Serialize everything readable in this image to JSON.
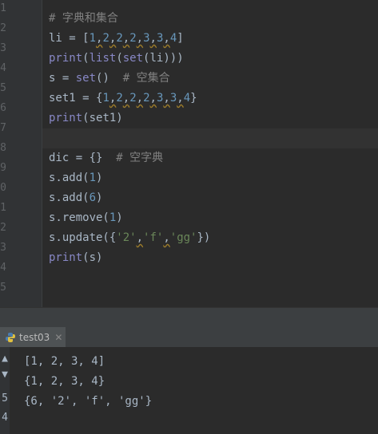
{
  "editor": {
    "line_numbers": [
      "1",
      "2",
      "3",
      "4",
      "5",
      "6",
      "7",
      "8",
      "9",
      "0",
      "1",
      "2",
      "3",
      "4",
      "5"
    ],
    "lines": [
      [
        {
          "t": "com",
          "v": "# 字典和集合"
        }
      ],
      [
        {
          "t": "p",
          "v": "li = ["
        },
        {
          "t": "num",
          "v": "1"
        },
        {
          "t": "typo",
          "v": ","
        },
        {
          "t": "num",
          "v": "2"
        },
        {
          "t": "typo",
          "v": ","
        },
        {
          "t": "num",
          "v": "2"
        },
        {
          "t": "typo",
          "v": ","
        },
        {
          "t": "num",
          "v": "2"
        },
        {
          "t": "typo",
          "v": ","
        },
        {
          "t": "num",
          "v": "3"
        },
        {
          "t": "typo",
          "v": ","
        },
        {
          "t": "num",
          "v": "3"
        },
        {
          "t": "typo",
          "v": ","
        },
        {
          "t": "num",
          "v": "4"
        },
        {
          "t": "p",
          "v": "]"
        }
      ],
      [
        {
          "t": "bi",
          "v": "print"
        },
        {
          "t": "p",
          "v": "("
        },
        {
          "t": "bi",
          "v": "list"
        },
        {
          "t": "p",
          "v": "("
        },
        {
          "t": "bi",
          "v": "set"
        },
        {
          "t": "p",
          "v": "(li)))"
        }
      ],
      [
        {
          "t": "p",
          "v": "s = "
        },
        {
          "t": "bi",
          "v": "set"
        },
        {
          "t": "p",
          "v": "()  "
        },
        {
          "t": "com",
          "v": "# 空集合"
        }
      ],
      [
        {
          "t": "p",
          "v": "set1 = {"
        },
        {
          "t": "num",
          "v": "1"
        },
        {
          "t": "typo",
          "v": ","
        },
        {
          "t": "num",
          "v": "2"
        },
        {
          "t": "typo",
          "v": ","
        },
        {
          "t": "num",
          "v": "2"
        },
        {
          "t": "typo",
          "v": ","
        },
        {
          "t": "num",
          "v": "2"
        },
        {
          "t": "typo",
          "v": ","
        },
        {
          "t": "num",
          "v": "3"
        },
        {
          "t": "typo",
          "v": ","
        },
        {
          "t": "num",
          "v": "3"
        },
        {
          "t": "typo",
          "v": ","
        },
        {
          "t": "num",
          "v": "4"
        },
        {
          "t": "p",
          "v": "}"
        }
      ],
      [
        {
          "t": "bi",
          "v": "print"
        },
        {
          "t": "p",
          "v": "(set1)"
        }
      ],
      [
        {
          "t": "p",
          "v": ""
        }
      ],
      [
        {
          "t": "p",
          "v": "dic = {}  "
        },
        {
          "t": "com",
          "v": "# 空字典"
        }
      ],
      [
        {
          "t": "p",
          "v": "s.add("
        },
        {
          "t": "num",
          "v": "1"
        },
        {
          "t": "p",
          "v": ")"
        }
      ],
      [
        {
          "t": "p",
          "v": "s.add("
        },
        {
          "t": "num",
          "v": "6"
        },
        {
          "t": "p",
          "v": ")"
        }
      ],
      [
        {
          "t": "p",
          "v": "s.remove("
        },
        {
          "t": "num",
          "v": "1"
        },
        {
          "t": "p",
          "v": ")"
        }
      ],
      [
        {
          "t": "p",
          "v": "s.update({"
        },
        {
          "t": "str",
          "v": "'2'"
        },
        {
          "t": "typo",
          "v": ","
        },
        {
          "t": "str",
          "v": "'f'"
        },
        {
          "t": "typo",
          "v": ","
        },
        {
          "t": "str",
          "v": "'gg'"
        },
        {
          "t": "p",
          "v": "})"
        }
      ],
      [
        {
          "t": "bi",
          "v": "print"
        },
        {
          "t": "p",
          "v": "(s)"
        }
      ],
      [
        {
          "t": "p",
          "v": ""
        }
      ]
    ]
  },
  "run_panel": {
    "tab_label": "test03",
    "tab_icon": "python-icon",
    "close_icon": "close-icon",
    "gutter_markers": [
      "▲",
      "▼",
      "5",
      "4"
    ],
    "output": [
      "[1, 2, 3, 4]",
      "{1, 2, 3, 4}",
      "{6, '2', 'f', 'gg'}"
    ]
  },
  "colors": {
    "background": "#2b2b2b",
    "comment": "#808080",
    "number": "#6897bb",
    "builtin": "#8888c6",
    "string": "#6a8759",
    "text": "#a9b7c6"
  }
}
